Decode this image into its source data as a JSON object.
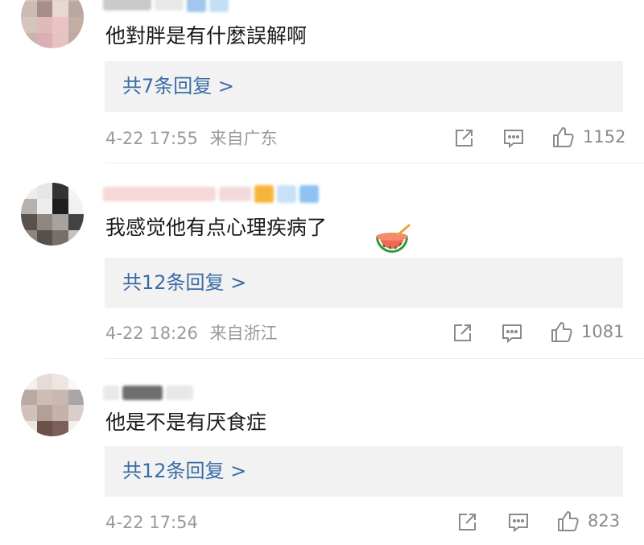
{
  "comments": [
    {
      "text": "他對胖是有什麼誤解啊",
      "reply_label": "共7条回复 >",
      "timestamp": "4-22 17:55",
      "location": "来自广东",
      "likes": "1152"
    },
    {
      "text": "我感觉他有点心理疾病了",
      "reply_label": "共12条回复 >",
      "timestamp": "4-22 18:26",
      "location": "来自浙江",
      "likes": "1081",
      "emoji": "watermelon-bowl-icon"
    },
    {
      "text": "他是不是有厌食症",
      "reply_label": "共12条回复 >",
      "timestamp": "4-22 17:54",
      "location": "",
      "likes": "823"
    }
  ],
  "icons": {
    "share": "share-icon",
    "comment": "comment-icon",
    "like": "thumbs-up-icon"
  },
  "colors": {
    "link": "#3a6ba5",
    "meta": "#9a9a9a",
    "reply_bg": "#f2f2f2"
  }
}
